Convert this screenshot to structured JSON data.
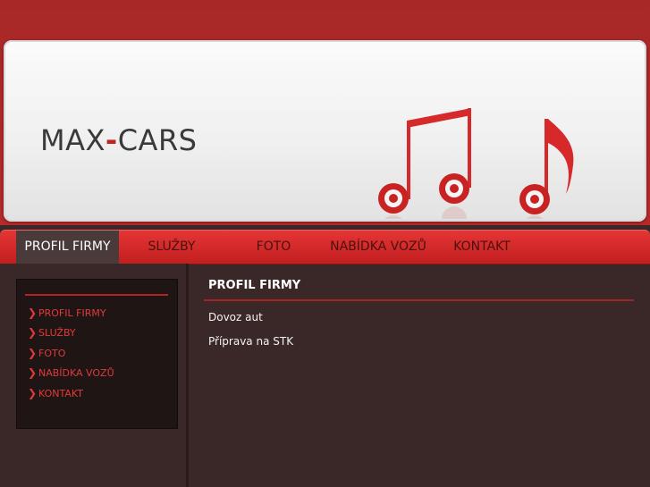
{
  "header": {
    "logo_part1": "MAX",
    "logo_dash": "-",
    "logo_part2": "CARS"
  },
  "nav": {
    "items": [
      "PROFIL FIRMY",
      "SLUŽBY",
      "FOTO",
      "NABÍDKA VOZŮ",
      "KONTAKT"
    ],
    "active": "PROFIL FIRMY"
  },
  "sidebar": {
    "items": [
      "PROFIL FIRMY",
      "SLUŽBY",
      "FOTO",
      "NABÍDKA VOZŮ",
      "KONTAKT"
    ]
  },
  "content": {
    "title": "PROFIL FIRMY",
    "lines": [
      "Dovoz aut",
      "Příprava na STK"
    ]
  },
  "colors": {
    "brand_red": "#c22222",
    "nav_red": "#e53535",
    "page_bg": "#3a2727",
    "sidebar_box": "#1f1515"
  },
  "icons": [
    "music-note-icon",
    "double-music-note-icon",
    "chevron-right-icon"
  ]
}
